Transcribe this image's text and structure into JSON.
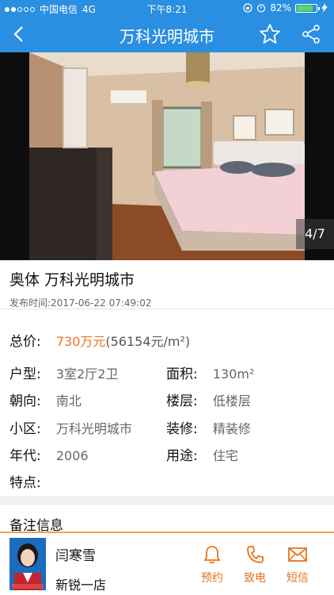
{
  "status_bar": {
    "carrier": "中国电信",
    "network": "4G",
    "time": "下午8:21",
    "battery": "82%",
    "battery_level": 0.82
  },
  "navbar": {
    "title": "万科光明城市",
    "back_icon": "chevron-left-icon",
    "favorite_icon": "star-icon",
    "share_icon": "share-icon"
  },
  "gallery": {
    "counter": "4/7"
  },
  "listing": {
    "title": "奥体 万科光明城市",
    "published": "发布时间:2017-06-22 07:49:02"
  },
  "details": {
    "price_label": "总价:",
    "price_value": "730万元",
    "price_unit_note": "(56154元/m²)",
    "layout_label": "户型:",
    "layout_value": "3室2厅2卫",
    "area_label": "面积:",
    "area_value": "130m²",
    "orientation_label": "朝向:",
    "orientation_value": "南北",
    "floor_label": "楼层:",
    "floor_value": "低楼层",
    "community_label": "小区:",
    "community_value": "万科光明城市",
    "decoration_label": "装修:",
    "decoration_value": "精装修",
    "year_label": "年代:",
    "year_value": "2006",
    "usage_label": "用途:",
    "usage_value": "住宅",
    "features_label": "特点:"
  },
  "notes": {
    "title": "备注信息"
  },
  "agent": {
    "name": "闫寒雪",
    "store": "新锐一店"
  },
  "actions": {
    "appointment": "预约",
    "call": "致电",
    "message": "短信"
  },
  "colors": {
    "header": "#2a8fe0",
    "accent": "#e6741e"
  }
}
